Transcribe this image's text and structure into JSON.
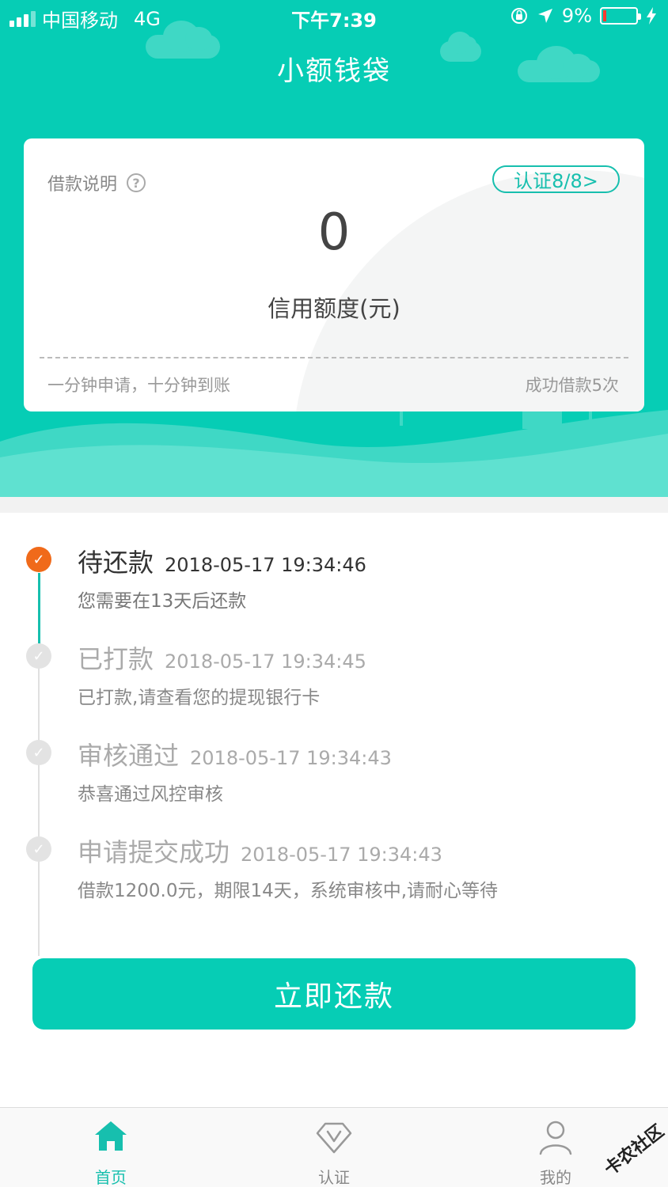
{
  "status_bar": {
    "carrier": "中国移动",
    "network": "4G",
    "time": "下午7:39",
    "battery": "9%",
    "battery_level": 0.09
  },
  "app_title": "小额钱袋",
  "credit_card": {
    "loan_note": "借款说明",
    "help_icon": "question-circle-icon",
    "certification": "认证8/8>",
    "amount": "0",
    "amount_label": "信用额度(元)",
    "slogan": "一分钟申请，十分钟到账",
    "success_count": "成功借款5次"
  },
  "timeline": [
    {
      "title": "待还款",
      "time": "2018-05-17 19:34:46",
      "desc": "您需要在13天后还款",
      "state": "active"
    },
    {
      "title": "已打款",
      "time": "2018-05-17 19:34:45",
      "desc": "已打款,请查看您的提现银行卡",
      "state": "done"
    },
    {
      "title": "审核通过",
      "time": "2018-05-17 19:34:43",
      "desc": "恭喜通过风控审核",
      "state": "done"
    },
    {
      "title": "申请提交成功",
      "time": "2018-05-17 19:34:43",
      "desc": "借款1200.0元，期限14天，系统审核中,请耐心等待",
      "state": "done"
    }
  ],
  "repay_button": "立即还款",
  "tab_bar": {
    "tabs": [
      {
        "label": "首页",
        "icon": "home-icon",
        "active": true
      },
      {
        "label": "认证",
        "icon": "verify-v-icon",
        "active": false
      },
      {
        "label": "我的",
        "icon": "user-icon",
        "active": false
      }
    ]
  },
  "watermark": "卡农社区",
  "colors": {
    "brand": "#06cdb5",
    "accent_orange": "#f06a1a"
  }
}
